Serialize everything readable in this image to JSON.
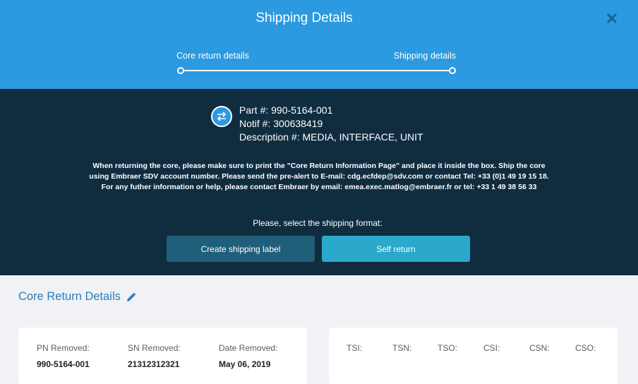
{
  "header": {
    "title": "Shipping Details",
    "close_label": "✕",
    "steps": [
      {
        "label": "Core return details"
      },
      {
        "label": "Shipping details"
      }
    ]
  },
  "part": {
    "part_number": "Part #: 990-5164-001",
    "notif": "Notif #: 300638419",
    "description": "Description #: MEDIA, INTERFACE, UNIT"
  },
  "notice": {
    "line1": "When returning the core, please make sure to print the \"Core Return Information Page\" and place it inside the box. Ship the core",
    "line2": "using Embraer SDV account number. Please send the pre-alert to E-mail: cdg.ecfdep@sdv.com or contact Tel: +33 (0)1 49 19 15 18.",
    "line3": "For any futher information or help, please contact Embraer by email: emea.exec.matlog@embraer.fr or tel: +33 1 49 38 56 33"
  },
  "shipping_format": {
    "prompt": "Please, select the shipping format:",
    "create_label": "Create shipping label",
    "self_return_label": "Self return"
  },
  "core_return": {
    "title": "Core Return Details",
    "pn_removed": {
      "label": "PN Removed:",
      "value": "990-5164-001"
    },
    "sn_removed": {
      "label": "SN Removed:",
      "value": "21312312321"
    },
    "date_removed": {
      "label": "Date Removed:",
      "value": "May 06, 2019"
    },
    "metrics": [
      "TSI:",
      "TSN:",
      "TSO:",
      "CSI:",
      "CSN:",
      "CSO:"
    ]
  },
  "colors": {
    "header_bg": "#2b9ae0",
    "panel_bg": "#102d40",
    "create_btn": "#1f5f7a",
    "self_btn": "#2aa9cc",
    "accent_text": "#2a7fb8"
  }
}
